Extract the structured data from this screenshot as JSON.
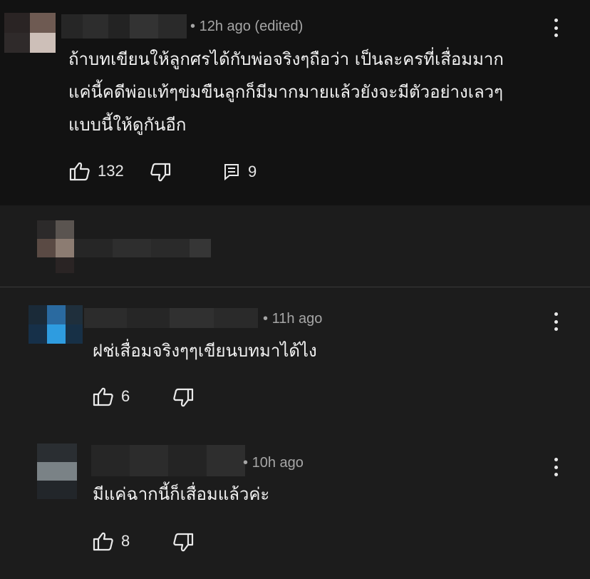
{
  "comments": [
    {
      "time": "12h ago (edited)",
      "text_lines": [
        "ถ้าบทเขียนให้ลูกศรได้กับพ่อจริงๆถือว่า เป็นละครที่เสื่อมมาก",
        "แค่นี้คดีพ่อแท้ๆข่มขืนลูกก็มีมากมายแล้วยังจะมีตัวอย่างเลวๆ",
        "แบบนี้ให้ดูกันอีก"
      ],
      "likes": "132",
      "replies": "9"
    },
    {
      "time": "11h ago",
      "text_lines": [
        "ฝช่เสื่อมจริงๆๆเขียนบทมาได้ไง"
      ],
      "likes": "6"
    },
    {
      "time": "10h ago",
      "text_lines": [
        "มีแค่ฉากนี้ก็เสื่อมแล้วค่ะ"
      ],
      "likes": "8"
    }
  ],
  "separator": "•",
  "icons": {
    "like": "thumbs-up-icon",
    "dislike": "thumbs-down-icon",
    "reply": "comment-icon",
    "menu": "more-vert-icon"
  },
  "colors": {
    "main_background": "#121212",
    "reply_background": "#1c1c1c",
    "meta_text": "#a6a6a6",
    "body_text": "#f1f1f1"
  }
}
